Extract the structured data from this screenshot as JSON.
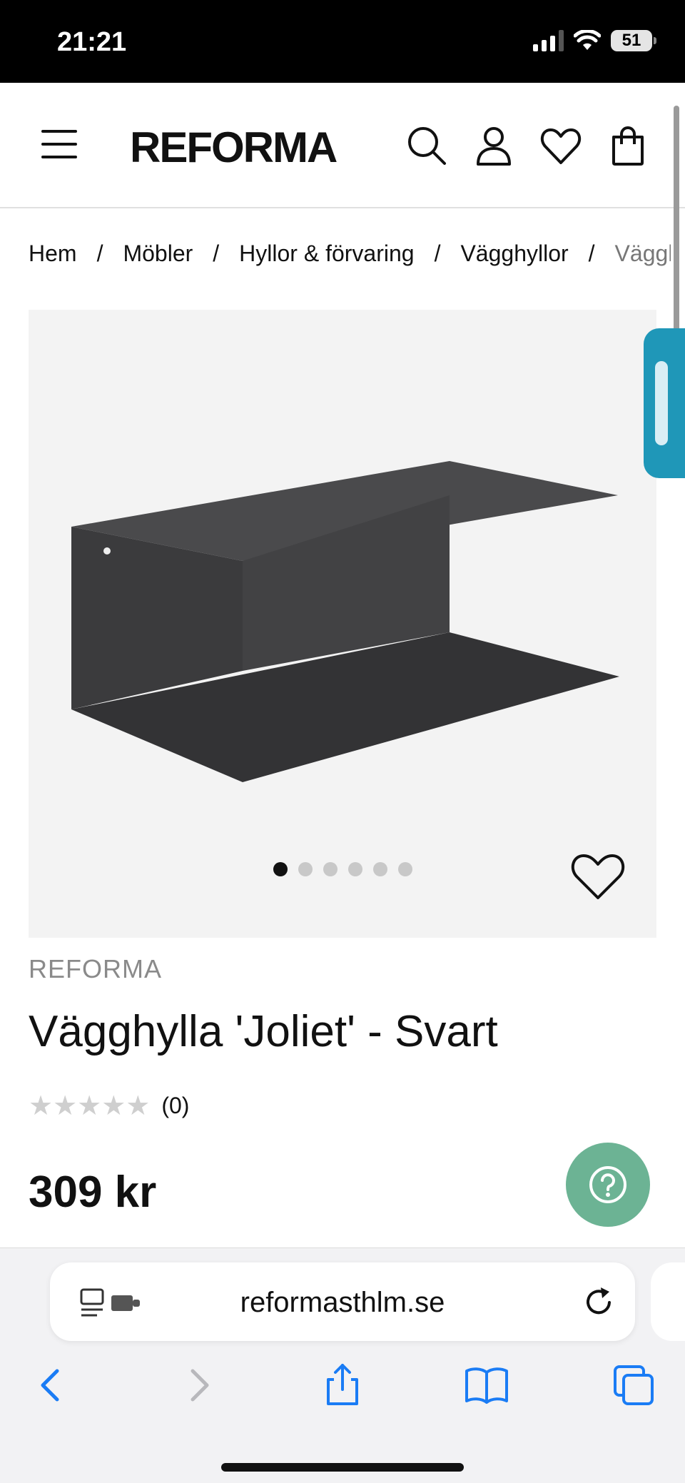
{
  "status_bar": {
    "time": "21:21",
    "battery": "51"
  },
  "header": {
    "logo": "REFORMA"
  },
  "breadcrumb": [
    "Hem",
    "Möbler",
    "Hyllor & förvaring",
    "Vägghyllor",
    "Vägghylla 'Joliet' - Svart"
  ],
  "gallery": {
    "image_count": 6,
    "active_index": 0
  },
  "product": {
    "brand": "REFORMA",
    "title": "Vägghylla 'Joliet' - Svart",
    "stars": "★★★★★",
    "rating": 0,
    "review_count": "(0)",
    "price": "309 kr"
  },
  "browser": {
    "url": "reformasthlm.se"
  },
  "colors": {
    "help_button": "#6cb394",
    "side_tab": "#1f97b8",
    "ios_blue": "#1a7cf5"
  }
}
